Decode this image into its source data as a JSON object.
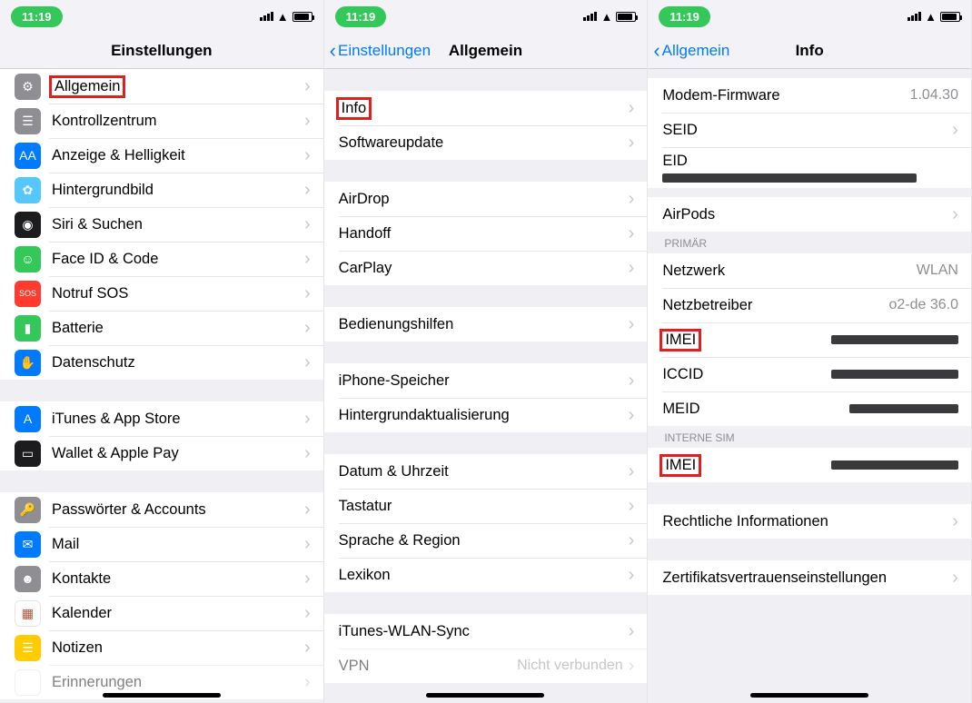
{
  "status": {
    "time": "11:19"
  },
  "screen1": {
    "title": "Einstellungen",
    "rows": {
      "general": "Allgemein",
      "control": "Kontrollzentrum",
      "display": "Anzeige & Helligkeit",
      "wallpaper": "Hintergrundbild",
      "siri": "Siri & Suchen",
      "faceid": "Face ID & Code",
      "sos": "Notruf SOS",
      "battery": "Batterie",
      "privacy": "Datenschutz",
      "itunes": "iTunes & App Store",
      "wallet": "Wallet & Apple Pay",
      "passwords": "Passwörter & Accounts",
      "mail": "Mail",
      "contacts": "Kontakte",
      "calendar": "Kalender",
      "notes": "Notizen",
      "reminders": "Erinnerungen"
    }
  },
  "screen2": {
    "back": "Einstellungen",
    "title": "Allgemein",
    "rows": {
      "info": "Info",
      "software": "Softwareupdate",
      "airdrop": "AirDrop",
      "handoff": "Handoff",
      "carplay": "CarPlay",
      "accessibility": "Bedienungshilfen",
      "storage": "iPhone-Speicher",
      "bgrefresh": "Hintergrundaktualisierung",
      "datetime": "Datum & Uhrzeit",
      "keyboard": "Tastatur",
      "language": "Sprache & Region",
      "dictionary": "Lexikon",
      "itunessync": "iTunes-WLAN-Sync",
      "vpn": "VPN",
      "vpn_value": "Nicht verbunden"
    }
  },
  "screen3": {
    "back": "Allgemein",
    "title": "Info",
    "rows": {
      "modem": "Modem-Firmware",
      "modem_value": "1.04.30",
      "seid": "SEID",
      "eid": "EID",
      "airpods": "AirPods",
      "section_primary": "PRIMÄR",
      "network": "Netzwerk",
      "network_value": "WLAN",
      "carrier": "Netzbetreiber",
      "carrier_value": "o2-de 36.0",
      "imei": "IMEI",
      "iccid": "ICCID",
      "meid": "MEID",
      "section_internal": "INTERNE SIM",
      "imei2": "IMEI",
      "legal": "Rechtliche Informationen",
      "cert": "Zertifikatsvertrauenseinstellungen"
    }
  }
}
